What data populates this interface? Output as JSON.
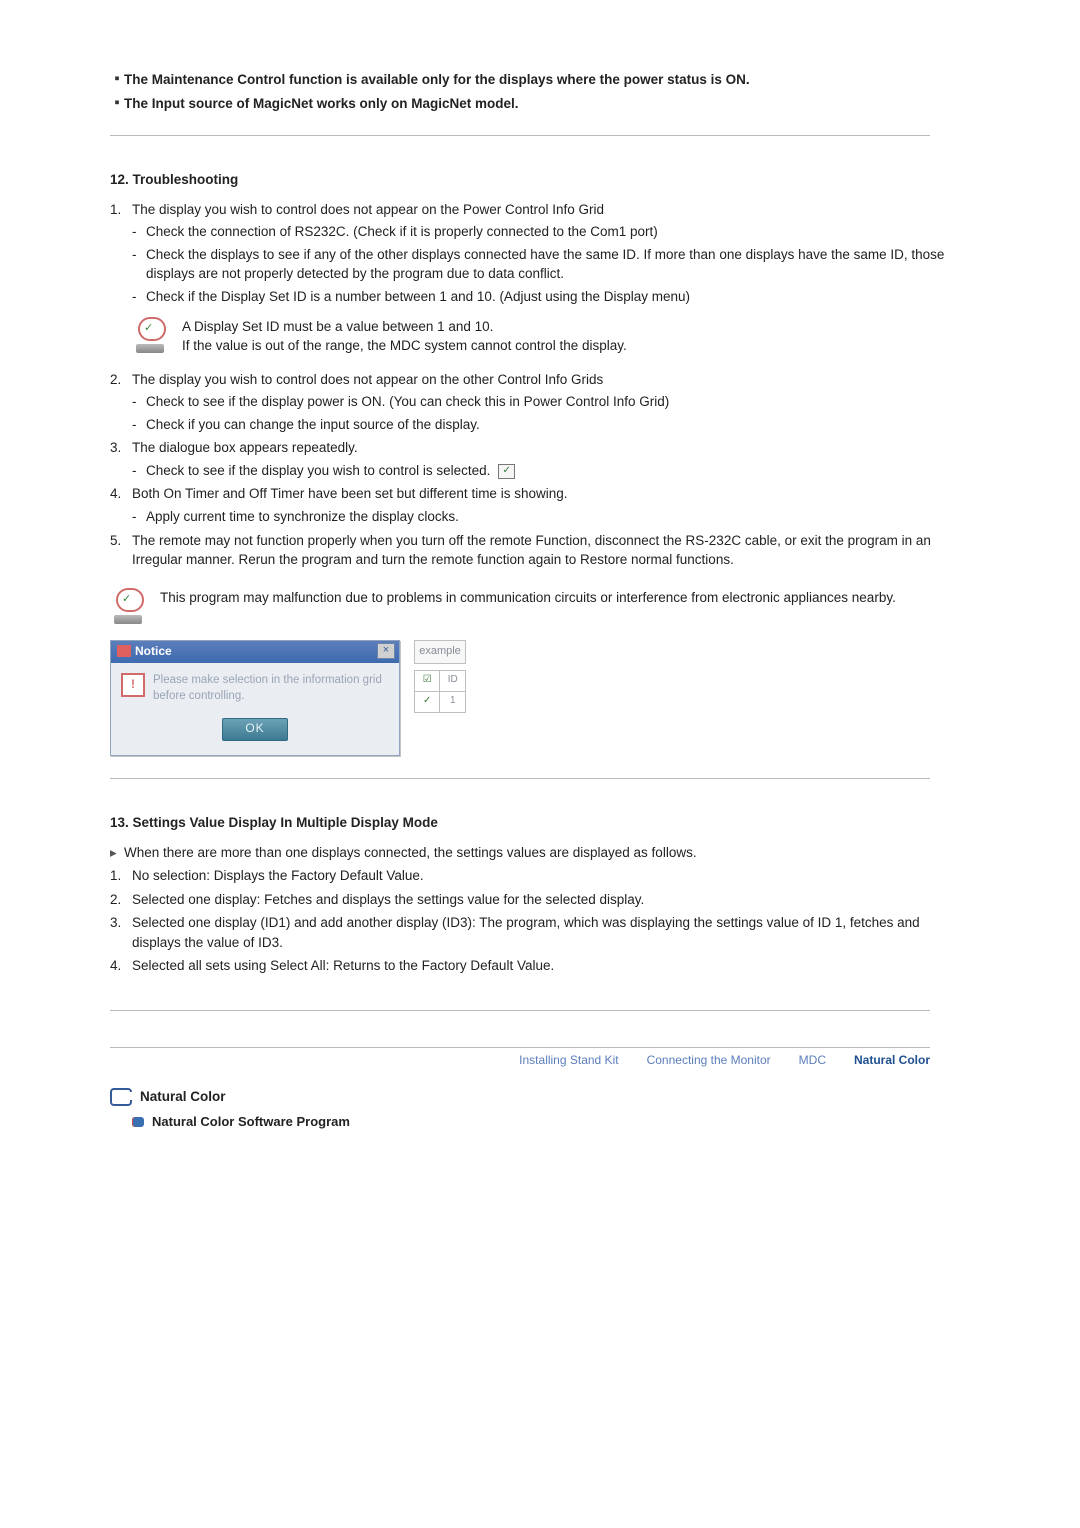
{
  "top_notes": [
    "The Maintenance Control function is available only for the displays where the power status is ON.",
    "The Input source of MagicNet works only on MagicNet model."
  ],
  "section12": {
    "title": "12. Troubleshooting",
    "items": [
      {
        "n": "1.",
        "title": "The display you wish to control does not appear on the Power Control Info Grid",
        "subs": [
          "Check the connection of RS232C. (Check if it is properly connected to the Com1 port)",
          "Check the displays to see if any of the other displays connected have the same ID. If more than one displays have the same ID, those displays are not properly detected by the program due to data conflict.",
          "Check if the Display Set ID is a number between 1 and 10. (Adjust using the Display menu)"
        ],
        "notice": [
          "A Display Set ID must be a value between 1 and 10.",
          "If the value is out of the range, the MDC system cannot control the display."
        ]
      },
      {
        "n": "2.",
        "title": "The display you wish to control does not appear on the other Control Info Grids",
        "subs": [
          "Check to see if the display power is ON. (You can check this in Power Control Info Grid)",
          "Check if you can change the input source of the display."
        ]
      },
      {
        "n": "3.",
        "title": "The dialogue box appears repeatedly.",
        "subs_with_check": [
          "Check to see if the display you wish to control is selected."
        ]
      },
      {
        "n": "4.",
        "title": "Both On Timer and Off Timer have been set but different time is showing.",
        "subs": [
          "Apply current time to synchronize the display clocks."
        ]
      },
      {
        "n": "5.",
        "title": "The remote may not function properly when you turn off the remote Function, disconnect the RS-232C cable, or exit the program in an Irregular manner. Rerun the program and turn the remote function again to Restore normal functions."
      }
    ],
    "final_notice": "This program may malfunction due to problems in communication circuits or interference from electronic appliances nearby.",
    "dialog": {
      "title": "Notice",
      "msg": "Please make selection in the information grid before controlling.",
      "ok": "OK"
    },
    "example_label": "example",
    "example_headers": [
      "☑",
      "ID"
    ],
    "example_row": [
      "✓",
      "1"
    ]
  },
  "section13": {
    "title": "13. Settings Value Display In Multiple Display Mode",
    "lead": "When there are more than one displays connected, the settings values are displayed as follows.",
    "items": [
      "No selection: Displays the Factory Default Value.",
      "Selected one display: Fetches and displays the settings value for the selected display.",
      "Selected one display (ID1) and add another display (ID3): The program, which was displaying the settings value of ID 1, fetches and displays the value of ID3.",
      "Selected all sets using Select All: Returns to the Factory Default Value."
    ]
  },
  "nav": {
    "links": [
      "Installing Stand Kit",
      "Connecting the Monitor",
      "MDC",
      "Natural Color"
    ],
    "active_index": 3
  },
  "natural_color": {
    "heading": "Natural Color",
    "sub": "Natural Color Software Program"
  }
}
